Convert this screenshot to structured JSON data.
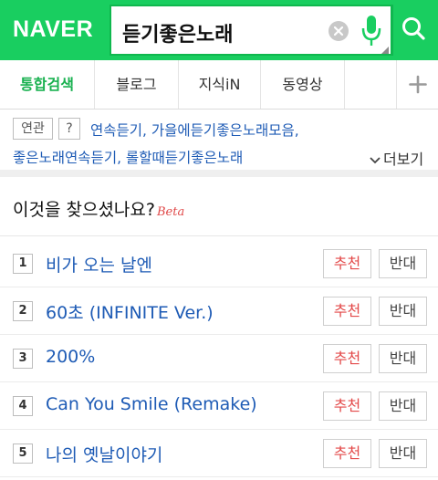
{
  "header": {
    "logo": "NAVER",
    "query": "듣기좋은노래",
    "colors": {
      "brand": "#19ce60",
      "mic": "#19ce60"
    }
  },
  "tabs": [
    {
      "label": "통합검색",
      "active": true
    },
    {
      "label": "블로그",
      "active": false
    },
    {
      "label": "지식iN",
      "active": false
    },
    {
      "label": "동영상",
      "active": false
    }
  ],
  "related": {
    "badge": "연관",
    "help": "?",
    "line1": "연속듣기, 가을에듣기좋은노래모음,",
    "line2": "좋은노래연속듣기, 롤할때듣기좋은노래",
    "more": "더보기"
  },
  "suggestions": {
    "title": "이것을 찾으셨나요?",
    "beta": "Beta",
    "recommend_label": "추천",
    "oppose_label": "반대",
    "items": [
      {
        "rank": "1",
        "title": "비가 오는 날엔"
      },
      {
        "rank": "2",
        "title": "60초 (INFINITE Ver.)"
      },
      {
        "rank": "3",
        "title": "200%"
      },
      {
        "rank": "4",
        "title": "Can You Smile (Remake)"
      },
      {
        "rank": "5",
        "title": "나의 옛날이야기"
      }
    ]
  }
}
